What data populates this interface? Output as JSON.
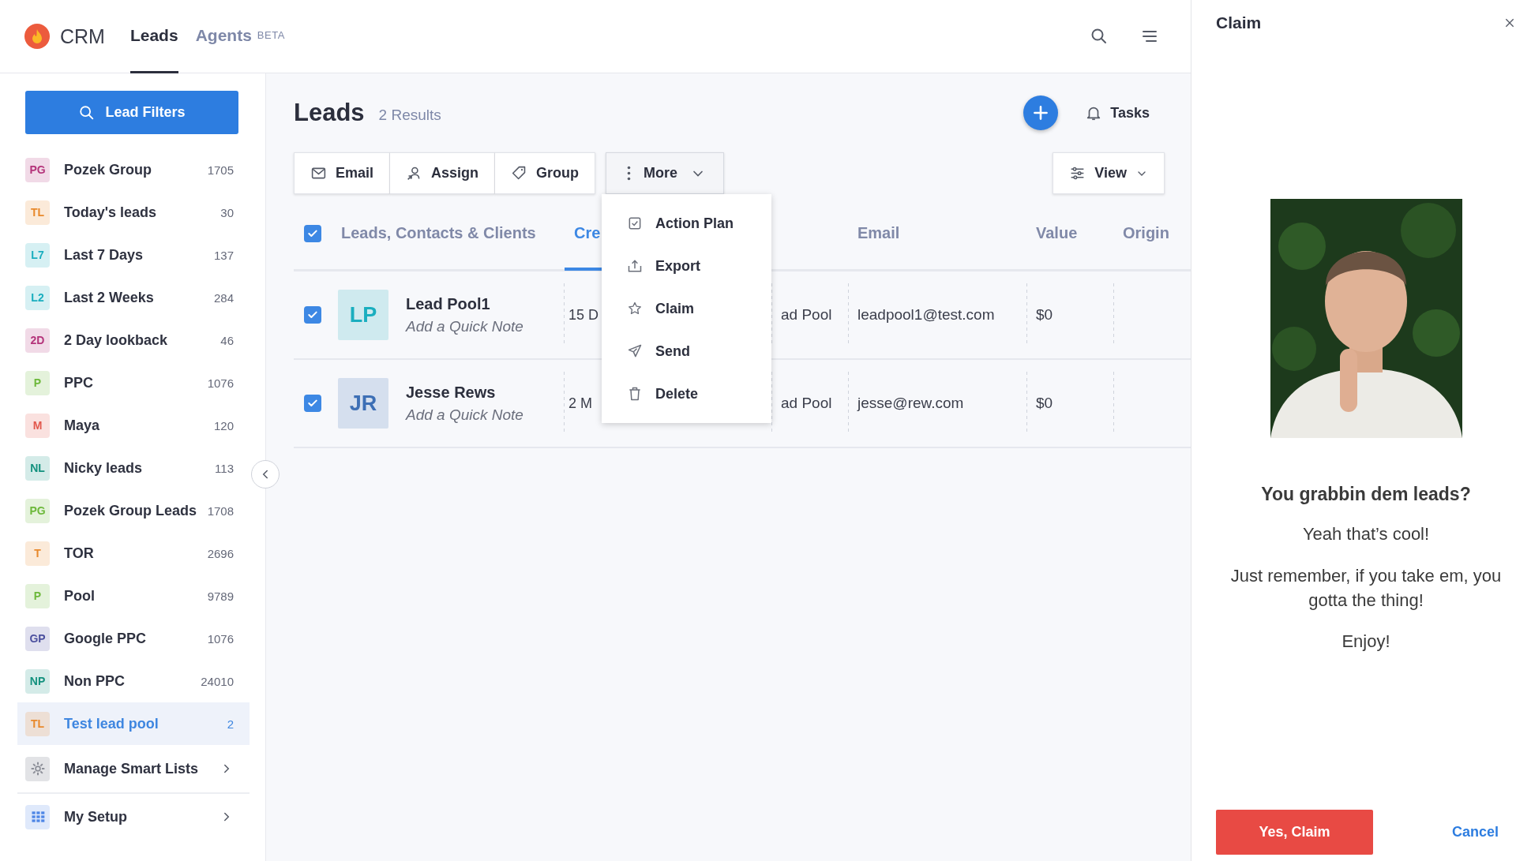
{
  "app": {
    "logo_text": "CRM"
  },
  "nav_tabs": [
    {
      "label": "Leads",
      "selected": true
    },
    {
      "label": "Agents",
      "badge": "BETA",
      "selected": false
    }
  ],
  "sidebar": {
    "filter_button": "Lead Filters",
    "lists": [
      {
        "initials": "PG",
        "name": "Pozek Group",
        "count": "1705",
        "color": "#b4337a",
        "selected": false
      },
      {
        "initials": "TL",
        "name": "Today's leads",
        "count": "30",
        "color": "#e8892c",
        "selected": false
      },
      {
        "initials": "L7",
        "name": "Last 7 Days",
        "count": "137",
        "color": "#1aaebf",
        "selected": false
      },
      {
        "initials": "L2",
        "name": "Last 2 Weeks",
        "count": "284",
        "color": "#1aaebf",
        "selected": false
      },
      {
        "initials": "2D",
        "name": "2 Day lookback",
        "count": "46",
        "color": "#b4337a",
        "selected": false
      },
      {
        "initials": "P",
        "name": "PPC",
        "count": "1076",
        "color": "#6cb83a",
        "selected": false
      },
      {
        "initials": "M",
        "name": "Maya",
        "count": "120",
        "color": "#e2574c",
        "selected": false
      },
      {
        "initials": "NL",
        "name": "Nicky leads",
        "count": "113",
        "color": "#13917e",
        "selected": false
      },
      {
        "initials": "PG",
        "name": "Pozek Group Leads",
        "count": "1708",
        "color": "#6cb83a",
        "selected": false
      },
      {
        "initials": "T",
        "name": "TOR",
        "count": "2696",
        "color": "#e8892c",
        "selected": false
      },
      {
        "initials": "P",
        "name": "Pool",
        "count": "9789",
        "color": "#6cb83a",
        "selected": false
      },
      {
        "initials": "GP",
        "name": "Google PPC",
        "count": "1076",
        "color": "#4b4f9e",
        "selected": false
      },
      {
        "initials": "NP",
        "name": "Non PPC",
        "count": "24010",
        "color": "#13917e",
        "selected": false
      },
      {
        "initials": "TL",
        "name": "Test lead pool",
        "count": "2",
        "color": "#e8892c",
        "selected": true
      }
    ],
    "links": [
      {
        "label": "Manage Smart Lists",
        "kind": "gear"
      },
      {
        "label": "My Setup",
        "kind": "grid"
      }
    ]
  },
  "page": {
    "title": "Leads",
    "result_count": "2 Results",
    "tasks_label": "Tasks",
    "actions": [
      {
        "label": "Email",
        "kind": "mail"
      },
      {
        "label": "Assign",
        "kind": "assign"
      },
      {
        "label": "Group",
        "kind": "tag"
      }
    ],
    "more": {
      "label": "More",
      "expanded": true,
      "menu": [
        {
          "label": "Action Plan",
          "kind": "check"
        },
        {
          "label": "Export",
          "kind": "export"
        },
        {
          "label": "Claim",
          "kind": "star"
        },
        {
          "label": "Send",
          "kind": "send"
        },
        {
          "label": "Delete",
          "kind": "trash"
        }
      ]
    },
    "view_button": "View"
  },
  "table": {
    "all_checked": true,
    "columns": [
      {
        "label": "Leads, Contacts & Clients",
        "kind": "name",
        "selected": false
      },
      {
        "label": "Cre",
        "kind": "created",
        "selected": true
      },
      {
        "label": "Email",
        "kind": "email",
        "selected": false
      },
      {
        "label": "Value",
        "kind": "value",
        "selected": false
      },
      {
        "label": "Origin",
        "kind": "origin",
        "selected": false
      }
    ],
    "rows": [
      {
        "checked": true,
        "initials": "LP",
        "color": "#1aaebf",
        "name": "Lead Pool1",
        "note": "Add a Quick Note",
        "created": "15 D",
        "column_4": "ad Pool",
        "email": "leadpool1@test.com",
        "value": "$0"
      },
      {
        "checked": true,
        "initials": "JR",
        "color": "#3d6fb5",
        "name": "Jesse Rews",
        "note": "Add a Quick Note",
        "created": "2 M",
        "column_4": "ad Pool",
        "email": "jesse@rew.com",
        "value": "$0"
      }
    ]
  },
  "claim_panel": {
    "title": "Claim",
    "heading": "You grabbin dem leads?",
    "paragraphs": [
      "Yeah that’s cool!",
      "Just remember, if you take em, you gotta the thing!",
      "Enjoy!"
    ],
    "confirm_button": "Yes, Claim",
    "cancel_button": "Cancel"
  }
}
